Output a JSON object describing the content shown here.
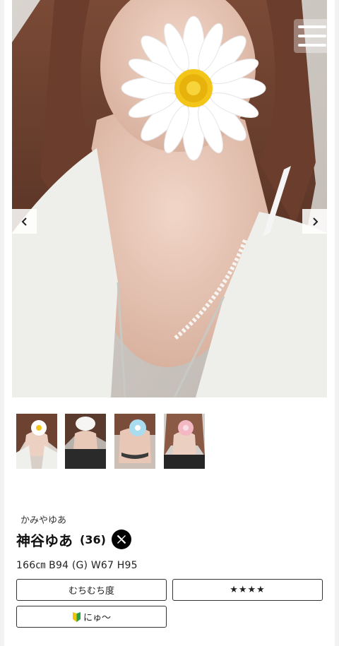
{
  "navigation": {
    "menu_icon": "hamburger-icon",
    "prev_icon": "chevron-left-icon",
    "next_icon": "chevron-right-icon"
  },
  "gallery": {
    "main_image": "profile photo (face covered by daisy sticker)",
    "thumbnails": [
      "photo-1",
      "photo-2",
      "photo-3",
      "photo-4"
    ]
  },
  "profile": {
    "kana": "かみやゆあ",
    "name": "神谷ゆあ",
    "age": "(36)",
    "social_icon": "x-logo-icon",
    "specs": "166㎝ B94 (G) W67 H95"
  },
  "tags": {
    "label": "むちむち度",
    "rating": "★★★★",
    "newbie": "にゅ〜"
  },
  "colors": {
    "accent_dark": "#111111",
    "border": "#333333",
    "gutter": "#f2f2f2"
  }
}
